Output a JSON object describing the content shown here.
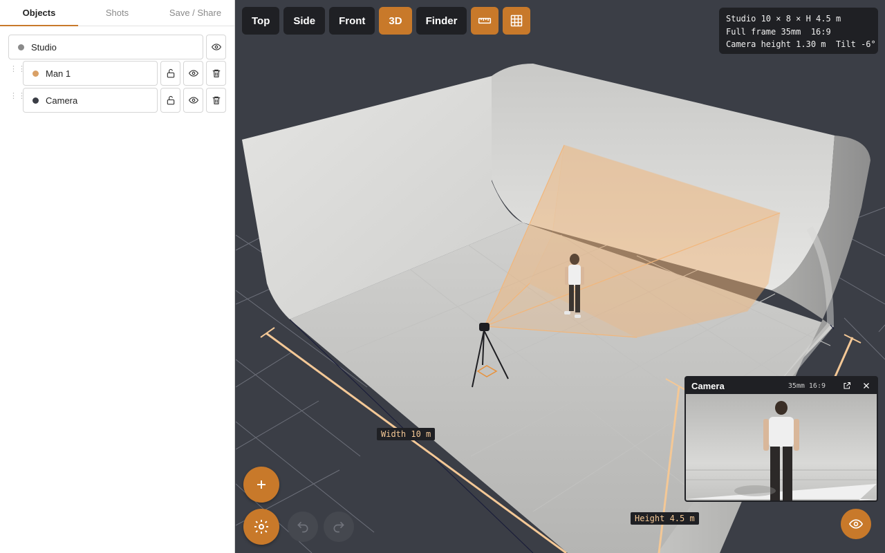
{
  "sidebar": {
    "tabs": [
      {
        "label": "Objects",
        "active": true
      },
      {
        "label": "Shots",
        "active": false
      },
      {
        "label": "Save / Share",
        "active": false
      }
    ],
    "objects": [
      {
        "label": "Studio",
        "color": "#8a8a8a"
      },
      {
        "label": "Man 1",
        "color": "#d9a066"
      },
      {
        "label": "Camera",
        "color": "#3a3d45"
      }
    ]
  },
  "toolbar": {
    "views": [
      {
        "label": "Top",
        "active": false
      },
      {
        "label": "Side",
        "active": false
      },
      {
        "label": "Front",
        "active": false
      },
      {
        "label": "3D",
        "active": true
      },
      {
        "label": "Finder",
        "active": false
      }
    ],
    "ruler_icon": "ruler-icon",
    "grid_icon": "grid-icon"
  },
  "info": {
    "line1": "Studio 10 × 8 × H 4.5 m",
    "line2": "Full frame 35mm  16:9",
    "line3": "Camera height 1.30 m  Tilt -6°"
  },
  "labels": {
    "width": "Width 10 m",
    "height": "Height 4.5 m"
  },
  "preview": {
    "title": "Camera",
    "spec": "35mm 16:9"
  },
  "colors": {
    "accent": "#c8792a",
    "dark": "#1f2024",
    "frustum": "#f2b67a"
  }
}
